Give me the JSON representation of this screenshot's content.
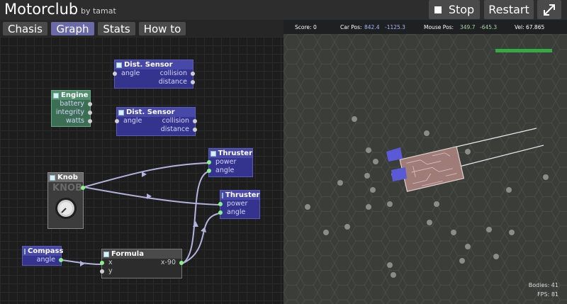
{
  "app": {
    "title": "Motorclub",
    "byline": "by tamat"
  },
  "controls": {
    "stop_label": "Stop",
    "restart_label": "Restart",
    "fullscreen_icon": "expand-icon"
  },
  "tabs": [
    {
      "label": "Chasis",
      "active": false
    },
    {
      "label": "Graph",
      "active": true
    },
    {
      "label": "Stats",
      "active": false
    },
    {
      "label": "How to",
      "active": false
    }
  ],
  "nodes": {
    "dist_sensor_1": {
      "title": "Dist. Sensor",
      "inputs": [
        "angle"
      ],
      "outputs": [
        "collision",
        "distance"
      ]
    },
    "dist_sensor_2": {
      "title": "Dist. Sensor",
      "inputs": [
        "angle"
      ],
      "outputs": [
        "collision",
        "distance"
      ]
    },
    "engine": {
      "title": "Engine",
      "outputs": [
        "battery",
        "integrity",
        "watts"
      ]
    },
    "thruster_1": {
      "title": "Thruster",
      "inputs": [
        "power",
        "angle"
      ]
    },
    "thruster_2": {
      "title": "Thruster",
      "inputs": [
        "power",
        "angle"
      ]
    },
    "knob": {
      "title": "Knob",
      "label": "KNOB"
    },
    "compass": {
      "title": "Compass",
      "outputs": [
        "angle"
      ]
    },
    "formula": {
      "title": "Formula",
      "inputs": [
        "x",
        "y"
      ],
      "expression": "x-90"
    }
  },
  "hud": {
    "score_label": "Score:",
    "score_value": "0",
    "carpos_label": "Car Pos:",
    "carpos_x": "842.4",
    "carpos_y": "-1125.3",
    "mousepos_label": "Mouse Pos:",
    "mousepos_x": "349.7",
    "mousepos_y": "-645.3",
    "vel_label": "Vel:",
    "vel_value": "67.865"
  },
  "stats": {
    "bodies": "Bodies: 41",
    "fps": "FPS: 81"
  },
  "colors": {
    "accent_tab": "#6a6aa8",
    "node_blue": "#34348e",
    "node_green": "#3b6e53",
    "wire": "#b3b3e0",
    "health": "#33aa44",
    "car_body": "#a07c78"
  }
}
